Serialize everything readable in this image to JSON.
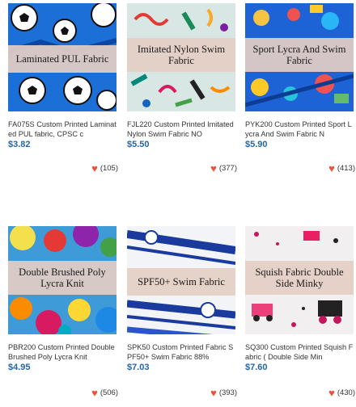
{
  "products": [
    {
      "banner": "Laminated PUL Fabric",
      "title": "FA075S Custom Printed Laminated PUL fabric, CPSC c",
      "price": "$3.82",
      "likes": "(105)",
      "theme": "soccer"
    },
    {
      "banner": "Imitated Nylon Swim Fabric",
      "title": "FJL220 Custom Printed Imitated Nylon Swim Fabric NO",
      "price": "$5.50",
      "likes": "(377)",
      "theme": "doodle"
    },
    {
      "banner": "Sport Lycra And Swim Fabric",
      "title": "PYK200 Custom Printed Sport Lycra And Swim Fabric N",
      "price": "$5.90",
      "likes": "(413)",
      "theme": "blue-cartoon"
    },
    {
      "banner": "Double Brushed Poly Lycra Knit",
      "title": "PBR200 Custom Printed Double Brushed Poly Lycra Knit",
      "price": "$4.95",
      "likes": "(506)",
      "theme": "rainbow"
    },
    {
      "banner": "SPF50+ Swim Fabric",
      "title": "SPK50 Custom Printed Fabric SPF50+ Swim Fabric 88%",
      "price": "$7.03",
      "likes": "(393)",
      "theme": "blue-stripes"
    },
    {
      "banner": "Squish Fabric Double Side Minky",
      "title": "SQ300 Custom Printed Squish Fabric ( Double Side Min",
      "price": "$7.60",
      "likes": "(430)",
      "theme": "pink-trucks"
    }
  ],
  "colors": {
    "price": "#2466a4",
    "heart": "#e8533b",
    "banner_bg": "#e4cec4"
  },
  "icons": {
    "like": "heart-icon"
  }
}
